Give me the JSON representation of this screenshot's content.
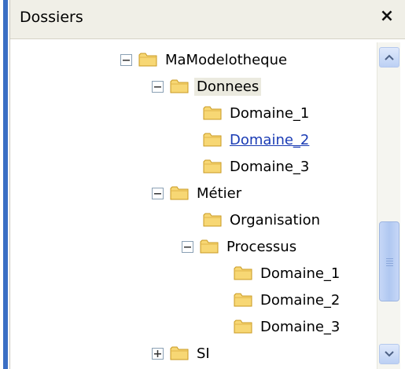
{
  "panel": {
    "title": "Dossiers",
    "close_label": "×"
  },
  "tree": {
    "nodes": [
      {
        "label": "MaModelotheque",
        "toggle": "minus"
      },
      {
        "label": "Donnees",
        "toggle": "minus",
        "state": "selected"
      },
      {
        "label": "Domaine_1"
      },
      {
        "label": "Domaine_2",
        "state": "hover-link"
      },
      {
        "label": "Domaine_3"
      },
      {
        "label": "Métier",
        "toggle": "minus"
      },
      {
        "label": "Organisation"
      },
      {
        "label": "Processus",
        "toggle": "minus"
      },
      {
        "label": "Domaine_1"
      },
      {
        "label": "Domaine_2"
      },
      {
        "label": "Domaine_3"
      },
      {
        "label": "SI",
        "toggle": "plus"
      }
    ]
  },
  "icons": {
    "folder": "folder-icon",
    "collapse": "minus-box-icon",
    "expand": "plus-box-icon",
    "close": "close-icon",
    "scroll_up": "chevron-up-icon",
    "scroll_down": "chevron-down-icon"
  },
  "colors": {
    "header_bg": "#f0efe7",
    "folder_fill": "#f7d774",
    "folder_stroke": "#c99a21",
    "link": "#1a3bb4",
    "selected_bg": "#ebeadf",
    "accent_strip": "#3b6fc4"
  }
}
